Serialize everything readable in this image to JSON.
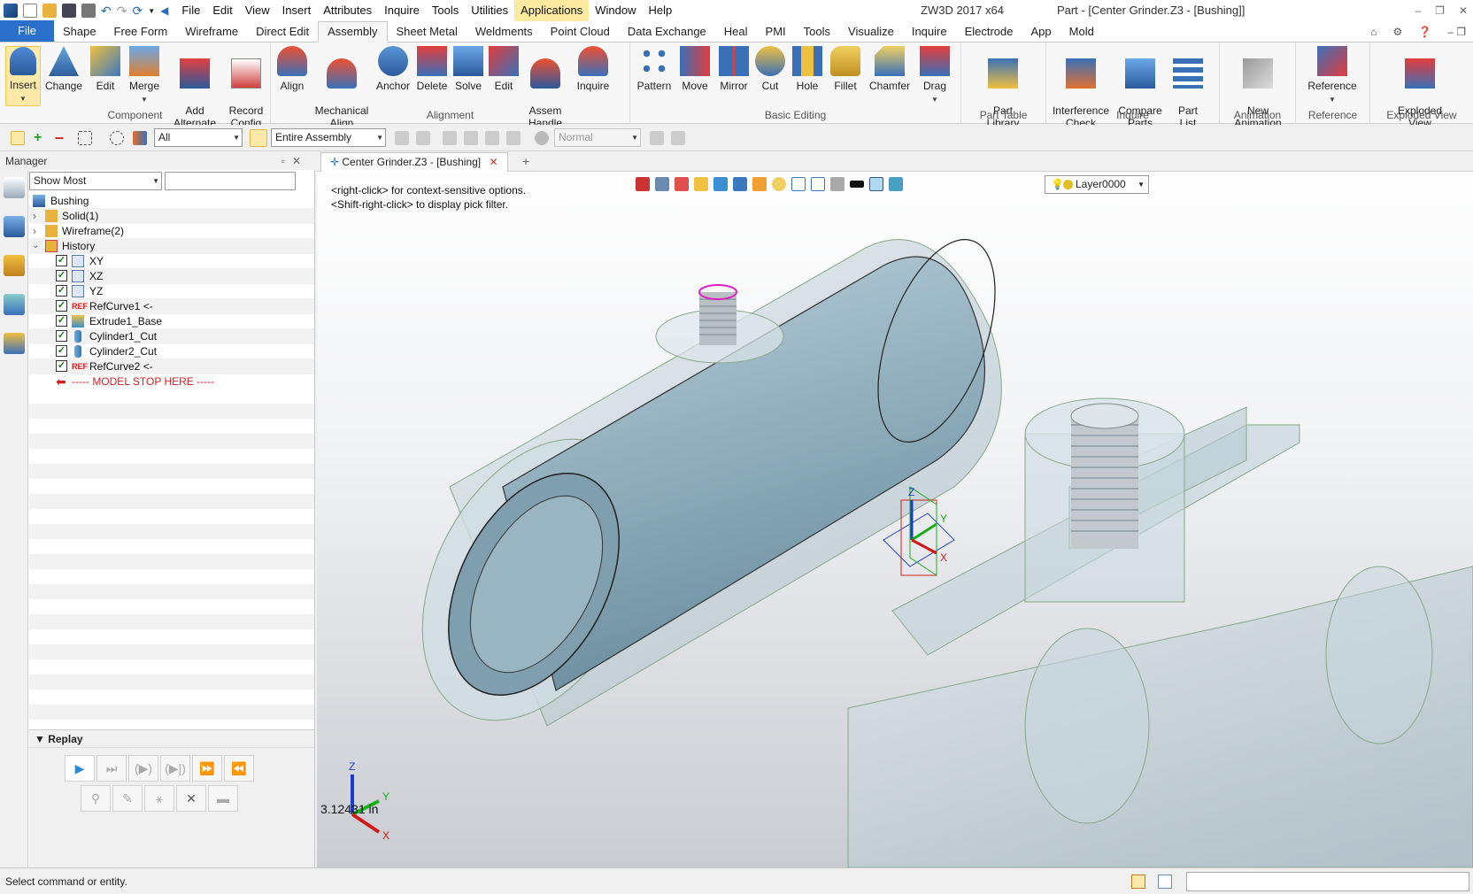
{
  "menu": [
    "File",
    "Edit",
    "View",
    "Insert",
    "Attributes",
    "Inquire",
    "Tools",
    "Utilities",
    "Applications",
    "Window",
    "Help"
  ],
  "app_title": "ZW3D 2017  x64",
  "doc_title": "Part - [Center Grinder.Z3 - [Bushing]]",
  "ribbon_tabs": [
    "File",
    "Shape",
    "Free Form",
    "Wireframe",
    "Direct Edit",
    "Assembly",
    "Sheet Metal",
    "Weldments",
    "Point Cloud",
    "Data Exchange",
    "Heal",
    "PMI",
    "Tools",
    "Visualize",
    "Inquire",
    "Electrode",
    "App",
    "Mold"
  ],
  "active_tab": "Assembly",
  "ribbon": {
    "component": {
      "label": "Component",
      "buttons": [
        {
          "label": "Insert"
        },
        {
          "label": "Change"
        },
        {
          "label": "Edit"
        },
        {
          "label": "Merge"
        },
        {
          "label": "Add\nAlternate"
        },
        {
          "label": "Record\nConfig"
        }
      ]
    },
    "alignment": {
      "label": "Alignment",
      "buttons": [
        {
          "label": "Align"
        },
        {
          "label": "Mechanical\nAlign"
        },
        {
          "label": "Anchor"
        },
        {
          "label": "Delete"
        },
        {
          "label": "Solve"
        },
        {
          "label": "Edit"
        },
        {
          "label": "Assem\nHandle"
        },
        {
          "label": "Inquire"
        }
      ]
    },
    "basic_editing": {
      "label": "Basic Editing",
      "buttons": [
        {
          "label": "Pattern"
        },
        {
          "label": "Move"
        },
        {
          "label": "Mirror"
        },
        {
          "label": "Cut"
        },
        {
          "label": "Hole"
        },
        {
          "label": "Fillet"
        },
        {
          "label": "Chamfer"
        },
        {
          "label": "Drag"
        }
      ]
    },
    "part_table": {
      "label": "Part Table",
      "buttons": [
        {
          "label": "Part\nLibrary"
        }
      ]
    },
    "inquire": {
      "label": "Inquire",
      "buttons": [
        {
          "label": "Interference\nCheck"
        },
        {
          "label": "Compare\nParts"
        },
        {
          "label": "Part\nList"
        }
      ]
    },
    "animation": {
      "label": "Animation",
      "buttons": [
        {
          "label": "New\nAnimation"
        }
      ]
    },
    "reference": {
      "label": "Reference",
      "buttons": [
        {
          "label": "Reference"
        }
      ]
    },
    "exploded": {
      "label": "Exploded View",
      "buttons": [
        {
          "label": "Exploded\nView"
        }
      ]
    }
  },
  "toolbar": {
    "filter_value": "All",
    "scope_value": "Entire Assembly",
    "mode_value": "Normal"
  },
  "manager": {
    "title": "Manager",
    "show_filter": "Show Most",
    "tree": [
      {
        "label": "Bushing",
        "level": 0
      },
      {
        "label": "Solid(1)",
        "level": 1
      },
      {
        "label": "Wireframe(2)",
        "level": 1
      },
      {
        "label": "History",
        "level": 1
      },
      {
        "label": "XY",
        "level": 2
      },
      {
        "label": "XZ",
        "level": 2
      },
      {
        "label": "YZ",
        "level": 2
      },
      {
        "label": "RefCurve1 <-",
        "level": 2
      },
      {
        "label": "Extrude1_Base",
        "level": 2
      },
      {
        "label": "Cylinder1_Cut",
        "level": 2
      },
      {
        "label": "Cylinder2_Cut",
        "level": 2
      },
      {
        "label": "RefCurve2 <-",
        "level": 2
      },
      {
        "label": "----- MODEL STOP HERE -----",
        "level": 2
      }
    ],
    "replay_label": "Replay"
  },
  "viewport": {
    "doc_tab": "Center Grinder.Z3 - [Bushing]",
    "layer": "Layer0000",
    "hint_1": "<right-click> for context-sensitive options.",
    "hint_2": "<Shift-right-click> to display pick filter.",
    "measurement": "3.12431 in",
    "axes": {
      "x": "X",
      "y": "Y",
      "z": "Z"
    }
  },
  "status": "Select command or entity.",
  "colors": {
    "file_tab": "#2a6fc9",
    "stop_marker": "#d42020",
    "part_fill": "#9cbccb",
    "highlight": "#fde9a8"
  }
}
